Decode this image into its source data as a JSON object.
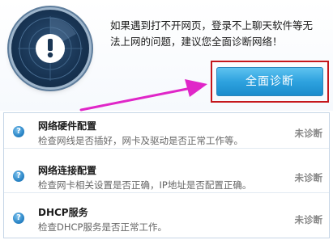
{
  "description": "如果遇到打不开网页，登录不上聊天软件等无法上网的问题，建议您全面诊断网络！",
  "diagnose_button": "全面诊断",
  "items": [
    {
      "title": "网络硬件配置",
      "subtitle": "检查网线是否插好，网卡及驱动是否正常工作等。",
      "status": "未诊断",
      "icon": "question-icon"
    },
    {
      "title": "网络连接配置",
      "subtitle": "检查网卡相关设置是否正确，IP地址是否配置正确。",
      "status": "未诊断",
      "icon": "question-icon"
    },
    {
      "title": "DHCP服务",
      "subtitle": "检查DHCP服务是否正常工作。",
      "status": "未诊断",
      "icon": "question-icon"
    }
  ],
  "colors": {
    "button": "#2ea2df",
    "highlight_border": "#c4161c",
    "arrow": "#e026c8",
    "radar": "#183453"
  },
  "icons": {
    "radar": "radar-exclamation-icon",
    "arrow": "pointer-arrow-icon"
  }
}
